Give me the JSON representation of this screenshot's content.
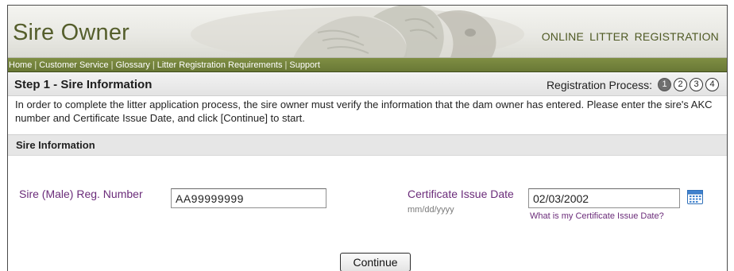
{
  "header": {
    "title": "Sire Owner",
    "tagline": "ONLINE LITTER REGISTRATION"
  },
  "nav": {
    "items": [
      "Home",
      "Customer Service",
      "Glossary",
      "Litter Registration Requirements",
      "Support"
    ],
    "separator": "|"
  },
  "step": {
    "title": "Step 1 - Sire Information",
    "process_label": "Registration Process:",
    "steps": [
      "1",
      "2",
      "3",
      "4"
    ],
    "current_step": 1
  },
  "intro": {
    "text": "In order to complete the litter application process, the sire owner must verify the information that the dam owner has entered. Please enter the sire's AKC number and Certificate Issue Date, and click [Continue] to start."
  },
  "section": {
    "title": "Sire Information"
  },
  "form": {
    "sire_label": "Sire (Male) Reg. Number",
    "sire_value": "AA99999999",
    "cert_label": "Certificate Issue Date",
    "cert_format": "mm/dd/yyyy",
    "cert_value": "02/03/2002",
    "help_link": "What is my Certificate Issue Date?",
    "calendar_icon": "calendar-icon"
  },
  "actions": {
    "continue_label": "Continue"
  },
  "colors": {
    "title": "#555e2c",
    "nav_bg": "#748339",
    "label": "#6b2c7a",
    "step_active": "#6f6f6f"
  }
}
